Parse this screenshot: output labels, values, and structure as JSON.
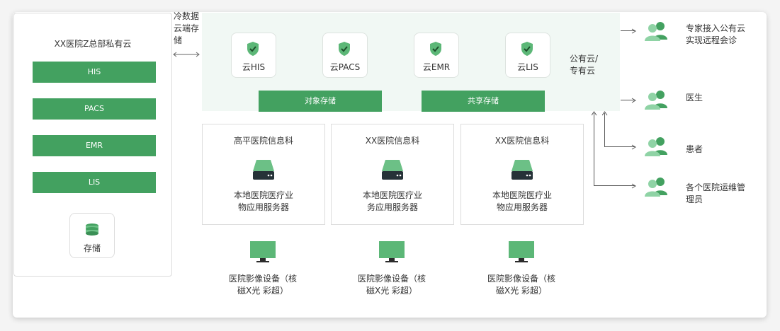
{
  "private_cloud": {
    "title": "XX医院Z总部私有云",
    "systems": [
      "HIS",
      "PACS",
      "EMR",
      "LIS"
    ],
    "storage_label": "存储"
  },
  "cold_storage": {
    "lines": [
      "冷数据",
      "云端存",
      "储"
    ]
  },
  "public_cloud": {
    "services": [
      "云HIS",
      "云PACS",
      "云EMR",
      "云LIS"
    ],
    "bars": [
      "对象存储",
      "共享存储"
    ],
    "label_lines": [
      "公有云/",
      "专有云"
    ]
  },
  "departments": [
    {
      "title": "高平医院信息科",
      "desc": [
        "本地医院医疗业",
        "物应用服务器"
      ]
    },
    {
      "title": "XX医院信息科",
      "desc": [
        "本地医院医疗业",
        "务应用服务器"
      ]
    },
    {
      "title": "XX医院信息科",
      "desc": [
        "本地医院医疗业",
        "物应用服务器"
      ]
    }
  ],
  "devices": [
    {
      "lines": [
        "医院影像设备（核",
        "磁X光 彩超）"
      ]
    },
    {
      "lines": [
        "医院影像设备（核",
        "磁X光 彩超）"
      ]
    },
    {
      "lines": [
        "医院影像设备（核",
        "磁X光 彩超）"
      ]
    }
  ],
  "users": [
    {
      "lines": [
        "专家接入公有云",
        "实现远程会诊"
      ]
    },
    {
      "lines": [
        "医生"
      ]
    },
    {
      "lines": [
        "患者"
      ]
    },
    {
      "lines": [
        "各个医院运维管",
        "理员"
      ]
    }
  ],
  "colors": {
    "accent": "#43a160",
    "icon_green": "#5cb777",
    "cloud_bg": "#f1f8f4"
  }
}
